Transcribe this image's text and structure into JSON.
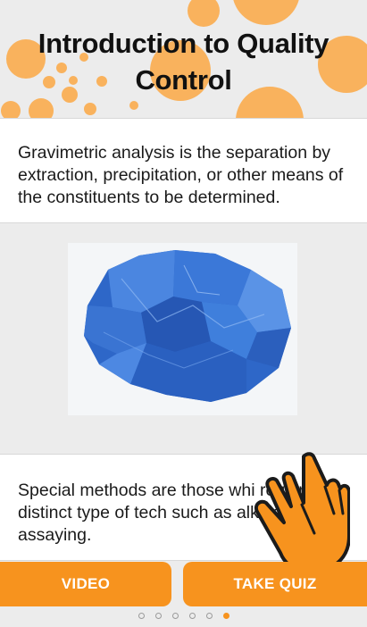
{
  "lesson": {
    "title": "Introduction to Quality Control",
    "paragraph_1": "Gravimetric analysis is the separation by extraction, precipitation, or other means of the constituents to be determined.",
    "paragraph_2_visible": "Special methods are those whi require a distinct type of tech such as alkaloidal assaying."
  },
  "image": {
    "subject": "blue crystal",
    "icon": "crystal-photo"
  },
  "overlay": {
    "icon": "pointing-hand-icon"
  },
  "actions": {
    "video_label": "VIDEO",
    "quiz_label": "TAKE QUIZ"
  },
  "pagination": {
    "total": 6,
    "active_index": 5
  },
  "colors": {
    "accent": "#f7931e",
    "accent_light": "#f9b25d",
    "background": "#ececec",
    "card": "#ffffff",
    "crystal_blue": "#2f6fd6"
  }
}
